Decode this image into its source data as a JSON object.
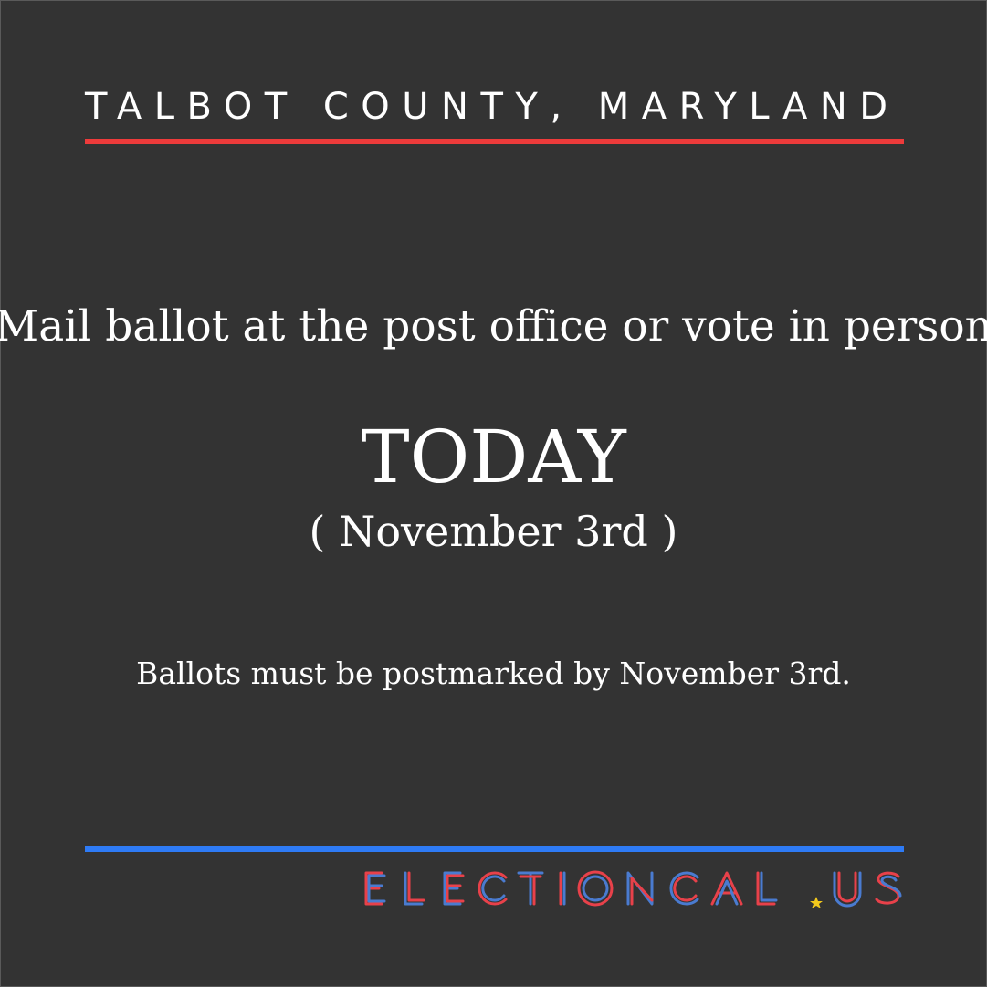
{
  "header": {
    "county": "TALBOT COUNTY, MARYLAND"
  },
  "main": {
    "instruction": "Mail ballot at the post office or vote in person",
    "headline": "TODAY",
    "date": "( November 3rd )",
    "note": "Ballots must be postmarked by November 3rd."
  },
  "footer": {
    "logo_text": "ELECTIONCAL.US"
  },
  "colors": {
    "background": "#333333",
    "top_rule": "#ee3b3b",
    "bottom_rule": "#2e7bf6",
    "logo_red": "#e8414a",
    "logo_blue": "#4a7bd0",
    "logo_star": "#f2c81c"
  }
}
